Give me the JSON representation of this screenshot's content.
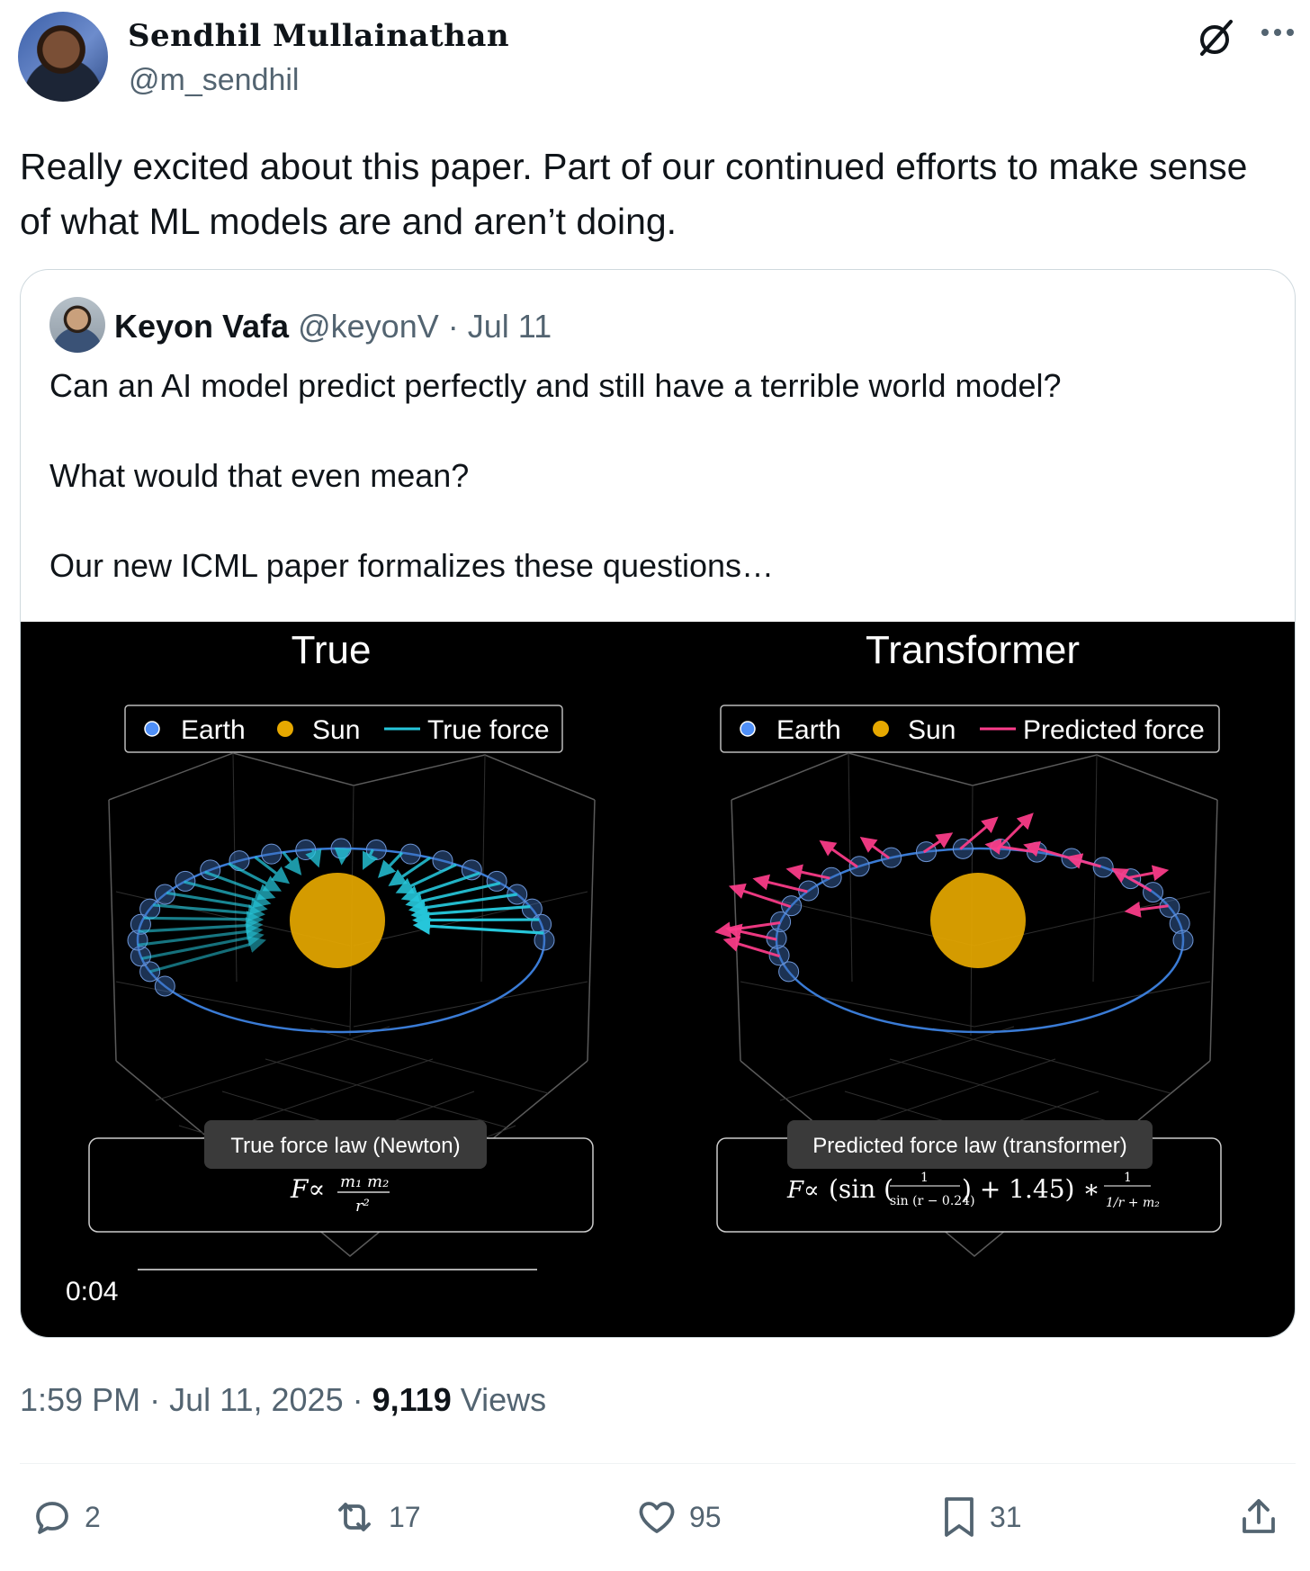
{
  "author": {
    "name": "Sendhil Mullainathan",
    "handle": "@m_sendhil"
  },
  "tweet": {
    "text": "Really excited about this paper.  Part of our continued efforts to make sense of what ML models are and aren’t doing."
  },
  "quote": {
    "name": "Keyon Vafa",
    "handle": "@keyonV",
    "separator": "·",
    "date": "Jul 11",
    "text": "Can an AI model predict perfectly and still have a terrible world model?\n\nWhat would that even mean?\n\nOur new ICML paper formalizes these questions…"
  },
  "media": {
    "left_title": "True",
    "right_title": "Transformer",
    "left_legend": [
      "Earth",
      "Sun",
      "True force"
    ],
    "right_legend": [
      "Earth",
      "Sun",
      "Predicted force"
    ],
    "left_formula_label": "True force law (Newton)",
    "right_formula_label": "Predicted force law (transformer)",
    "video_time": "0:04",
    "colors": {
      "earth": "#4f8ff7",
      "sun": "#e6a800",
      "true_force": "#26c6da",
      "predicted_force": "#ff3d8b",
      "orbit": "#3a7bd5"
    }
  },
  "meta": {
    "time": "1:59 PM",
    "sep1": "·",
    "date": "Jul 11, 2025",
    "sep2": "·",
    "views_count": "9,119",
    "views_label": "Views"
  },
  "actions": {
    "replies": "2",
    "retweets": "17",
    "likes": "95",
    "bookmarks": "31"
  },
  "icons": [
    "grok-icon",
    "more-icon",
    "reply-icon",
    "retweet-icon",
    "heart-icon",
    "bookmark-icon",
    "share-icon"
  ]
}
